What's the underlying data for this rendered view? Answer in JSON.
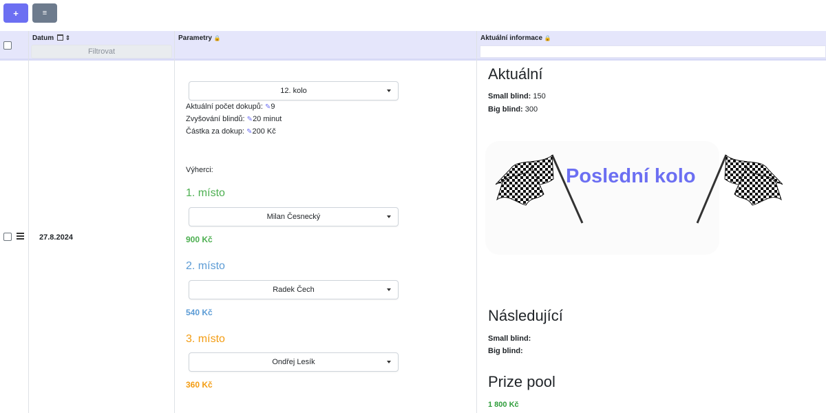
{
  "toolbar": {
    "add_label": "+",
    "menu_label": "≡"
  },
  "table": {
    "headers": {
      "datum": "Datum",
      "parametry": "Parametry",
      "info": "Aktuální informace"
    },
    "filter_label": "Filtrovat",
    "row": {
      "date": "27.8.2024",
      "round": "12. kolo",
      "rebuys_label": "Aktuální počet dokupů:",
      "rebuys_value": "9",
      "blinds_label": "Zvyšování blindů:",
      "blinds_value": "20 minut",
      "rebuy_amount_label": "Částka za dokup:",
      "rebuy_amount_value": "200 Kč",
      "winners_label": "Výherci:",
      "places": [
        {
          "title": "1. místo",
          "player": "Milan Česnecký",
          "prize": "900 Kč",
          "color": "#4caf50"
        },
        {
          "title": "2. místo",
          "player": "Radek Čech",
          "prize": "540 Kč",
          "color": "#5b9bd5"
        },
        {
          "title": "3. místo",
          "player": "Ondřej Lesík",
          "prize": "360 Kč",
          "color": "#f39c12"
        }
      ]
    },
    "info": {
      "current_title": "Aktuální",
      "small_blind_label": "Small blind:",
      "small_blind_value": "150",
      "big_blind_label": "Big blind:",
      "big_blind_value": "300",
      "last_round": "Poslední kolo",
      "next_title": "Následující",
      "next_small_label": "Small blind:",
      "next_big_label": "Big blind:",
      "prize_pool_title": "Prize pool",
      "prize_pool_value": "1 800 Kč"
    }
  },
  "colors": {
    "accent": "#6c6ff2",
    "header_bg": "#e5e6fb",
    "prize_pool": "#2e9d3a"
  }
}
